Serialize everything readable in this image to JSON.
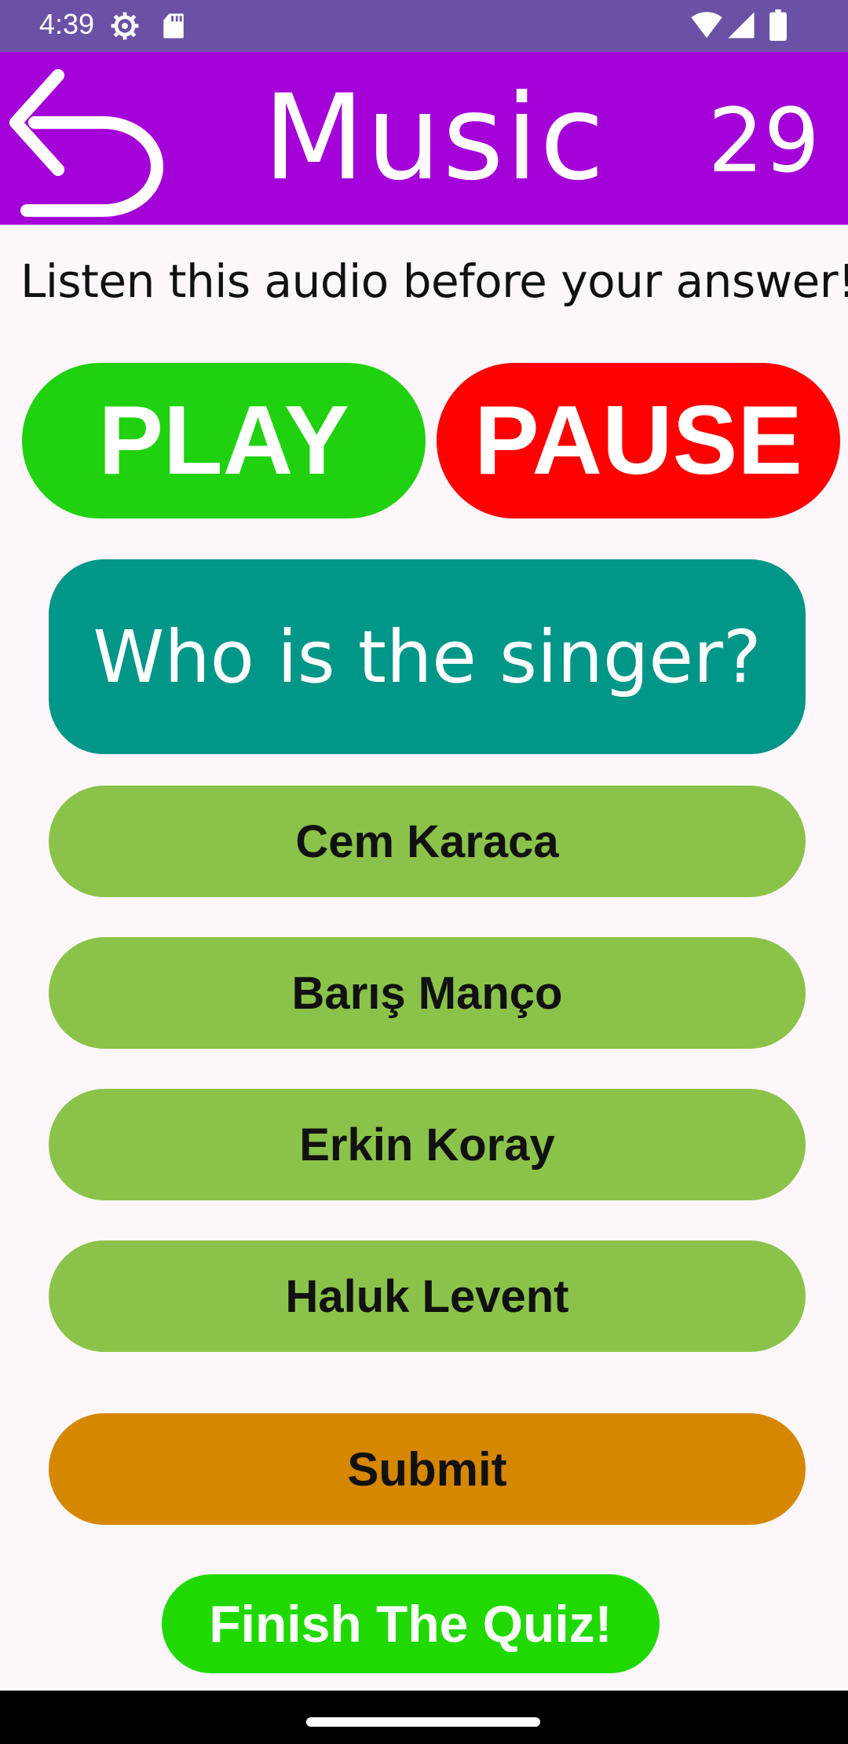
{
  "status_bar": {
    "time": "4:39",
    "icons": [
      "gear-icon",
      "sd-card-icon",
      "wifi-icon",
      "signal-icon",
      "battery-icon"
    ]
  },
  "app_bar": {
    "back_icon": "back-arrow-icon",
    "title": "Music",
    "timer": "29"
  },
  "instruction": "Listen this audio before your answer!",
  "controls": {
    "play_label": "PLAY",
    "pause_label": "PAUSE"
  },
  "question": "Who is the singer?",
  "options": [
    {
      "label": "Cem Karaca"
    },
    {
      "label": "Barış Manço"
    },
    {
      "label": "Erkin Koray"
    },
    {
      "label": "Haluk Levent"
    }
  ],
  "submit_label": "Submit",
  "finish_label": "Finish The Quiz!",
  "colors": {
    "status_bar": "#6a51a6",
    "app_bar": "#a400d8",
    "play": "#20d10f",
    "pause": "#ff0000",
    "question": "#009688",
    "option": "#8bc34a",
    "submit": "#d68700",
    "finish": "#20d900"
  }
}
